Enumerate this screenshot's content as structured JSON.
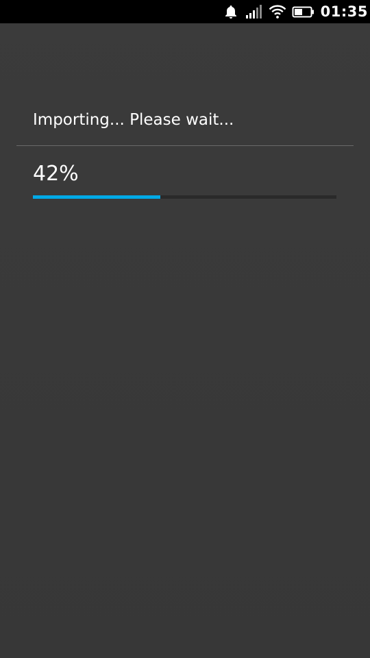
{
  "status_bar": {
    "time": "01:35",
    "icons": [
      "bell-icon",
      "signal-icon",
      "wifi-icon",
      "battery-icon"
    ]
  },
  "import_dialog": {
    "title": "Importing... Please wait...",
    "progress_text": "42%",
    "progress_value": 0.42,
    "progress_color": "#00a9e6"
  }
}
